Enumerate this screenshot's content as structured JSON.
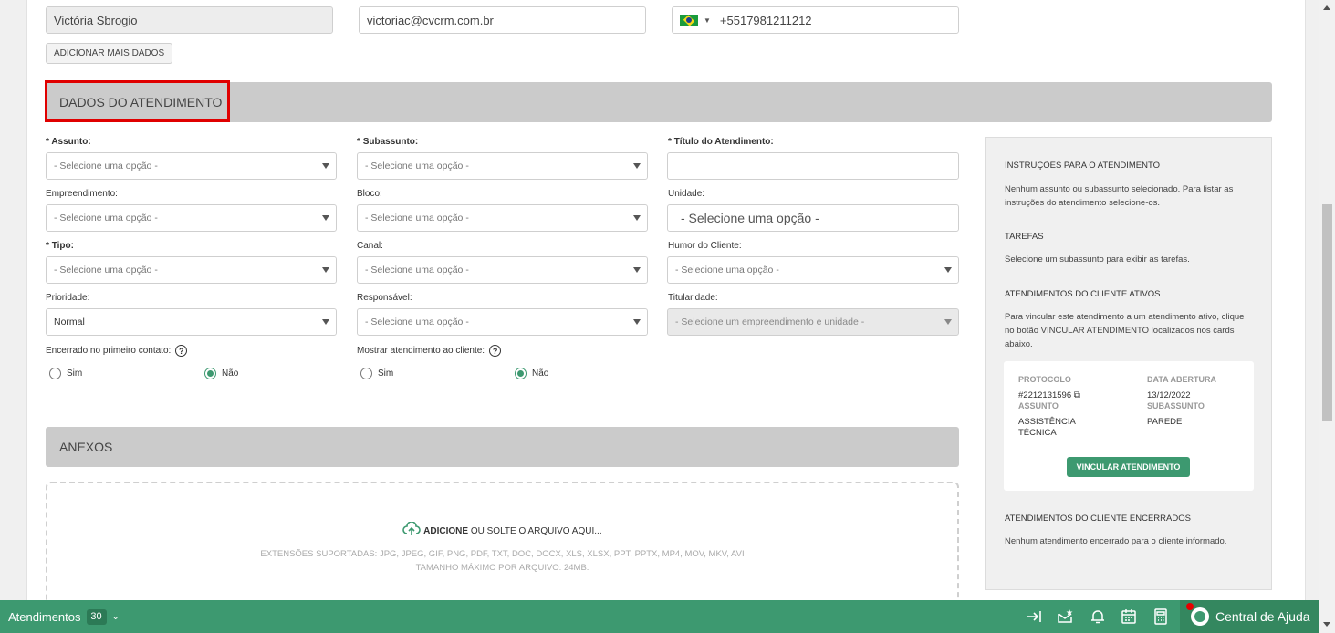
{
  "contact": {
    "name": "Victória Sbrogio",
    "email": "victoriac@cvcrm.com.br",
    "phone": "+5517981211212",
    "add_more_label": "ADICIONAR MAIS DADOS"
  },
  "sections": {
    "atendimento_title": "DADOS DO ATENDIMENTO",
    "anexos_title": "ANEXOS"
  },
  "form": {
    "assunto": {
      "label_req": "*",
      "label": "Assunto:",
      "placeholder": "- Selecione uma opção -"
    },
    "subassunto": {
      "label_req": "*",
      "label": "Subassunto:",
      "placeholder": "- Selecione uma opção -"
    },
    "titulo": {
      "label_req": "*",
      "label": "Título do Atendimento:",
      "value": ""
    },
    "empreendimento": {
      "label": "Empreendimento:",
      "placeholder": "- Selecione uma opção -"
    },
    "bloco": {
      "label": "Bloco:",
      "placeholder": "- Selecione uma opção -"
    },
    "unidade": {
      "label": "Unidade:",
      "placeholder": "- Selecione uma opção -"
    },
    "tipo": {
      "label_req": "*",
      "label": "Tipo:",
      "placeholder": "- Selecione uma opção -"
    },
    "canal": {
      "label": "Canal:",
      "placeholder": "- Selecione uma opção -"
    },
    "humor": {
      "label": "Humor do Cliente:",
      "placeholder": "- Selecione uma opção -"
    },
    "prioridade": {
      "label": "Prioridade:",
      "value": "Normal"
    },
    "responsavel": {
      "label": "Responsável:",
      "placeholder": "- Selecione uma opção -"
    },
    "titularidade": {
      "label": "Titularidade:",
      "placeholder": "- Selecione um empreendimento e unidade -"
    },
    "encerrado": {
      "label": "Encerrado no primeiro contato:",
      "help": "?",
      "opt_yes": "Sim",
      "opt_no": "Não",
      "selected": "Não"
    },
    "mostrar": {
      "label": "Mostrar atendimento ao cliente:",
      "help": "?",
      "opt_yes": "Sim",
      "opt_no": "Não",
      "selected": "Não"
    }
  },
  "upload": {
    "action": "ADICIONE",
    "rest": " OU SOLTE O ARQUIVO AQUI...",
    "extensions": "EXTENSÕES SUPORTADAS: JPG, JPEG, GIF, PNG, PDF, TXT, DOC, DOCX, XLS, XLSX, PPT, PPTX, MP4, MOV, MKV, AVI",
    "max_size": "TAMANHO MÁXIMO POR ARQUIVO: 24MB."
  },
  "sidebar": {
    "instrucoes_title": "INSTRUÇÕES PARA O ATENDIMENTO",
    "instrucoes_text": "Nenhum assunto ou subassunto selecionado. Para listar as instruções do atendimento selecione-os.",
    "tarefas_title": "TAREFAS",
    "tarefas_text": "Selecione um subassunto para exibir as tarefas.",
    "ativos_title": "ATENDIMENTOS DO CLIENTE ATIVOS",
    "ativos_text": "Para vincular este atendimento a um atendimento ativo, clique no botão VINCULAR ATENDIMENTO localizados nos cards abaixo.",
    "card": {
      "protocolo_label": "PROTOCOLO",
      "protocolo_value": "#2212131596",
      "data_label": "DATA ABERTURA",
      "data_value": "13/12/2022",
      "assunto_label": "ASSUNTO",
      "assunto_value": "ASSISTÊNCIA TÉCNICA",
      "subassunto_label": "SUBASSUNTO",
      "subassunto_value": "PAREDE",
      "button": "VINCULAR ATENDIMENTO"
    },
    "encerrados_title": "ATENDIMENTOS DO CLIENTE ENCERRADOS",
    "encerrados_text": "Nenhum atendimento encerrado para o cliente informado."
  },
  "bottombar": {
    "atendimentos_label": "Atendimentos",
    "atendimentos_count": "30",
    "help_label": "Central de Ajuda"
  },
  "colors": {
    "accent": "#3d9970",
    "highlight": "#e00000"
  }
}
